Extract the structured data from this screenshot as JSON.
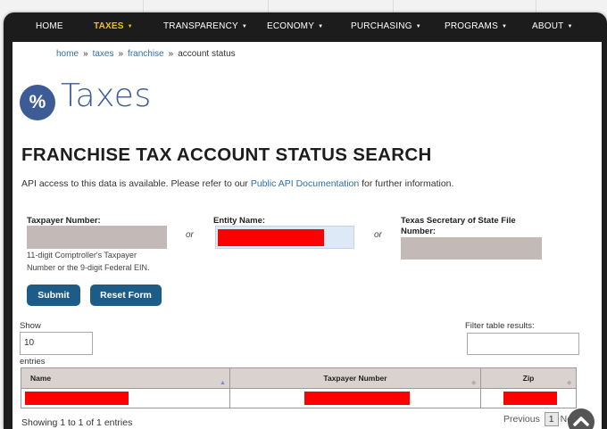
{
  "nav": {
    "items": [
      {
        "label": "HOME",
        "caret": ""
      },
      {
        "label": "TAXES",
        "caret": "▼"
      },
      {
        "label": "TRANSPARENCY",
        "caret": "▼"
      },
      {
        "label": "ECONOMY",
        "caret": "▼"
      },
      {
        "label": "PURCHASING",
        "caret": "▼"
      },
      {
        "label": "PROGRAMS",
        "caret": "▼"
      },
      {
        "label": "ABOUT",
        "caret": "▼"
      }
    ],
    "active_index": 1,
    "active_color": "#f3c300"
  },
  "breadcrumb": {
    "items": [
      "home",
      "taxes",
      "franchise"
    ],
    "current": "account status",
    "separator": "»"
  },
  "brand": {
    "badge": "%",
    "title": "Taxes",
    "color": "#3d5b95"
  },
  "page_title": "FRANCHISE TAX ACCOUNT STATUS SEARCH",
  "intro": {
    "before": "API access to this data is available. Please refer to our ",
    "link": "Public API Documentation",
    "after": " for further information."
  },
  "form": {
    "taxpayer_label": "Taxpayer Number:",
    "entity_label": "Entity Name:",
    "sos_label_line1": "Texas Secretary of State File",
    "sos_label_line2": "Number:",
    "or_text": "or",
    "taxpayer_help_line1": "11-digit Comptroller's Taxpayer",
    "taxpayer_help_line2": "Number or the 9-digit Federal EIN.",
    "submit_label": "Submit",
    "reset_label": "Reset Form"
  },
  "table_controls": {
    "show_label": "Show",
    "show_value": "10",
    "entries_label": "entries",
    "filter_label": "Filter table results:"
  },
  "table": {
    "columns": [
      "Name",
      "Taxpayer Number",
      "Zip"
    ]
  },
  "footer": {
    "info": "Showing 1 to 1 of 1 entries",
    "previous": "Previous",
    "current_page": "1",
    "next": "Ne"
  },
  "colors": {
    "button": "#1c5c86",
    "redaction": "#ff0000",
    "link": "#2f6ea7",
    "table_header": "#d9d2cf"
  },
  "icons": {
    "scroll_to_top": "chevron-up-icon",
    "sort": "sort-arrows-icon"
  }
}
